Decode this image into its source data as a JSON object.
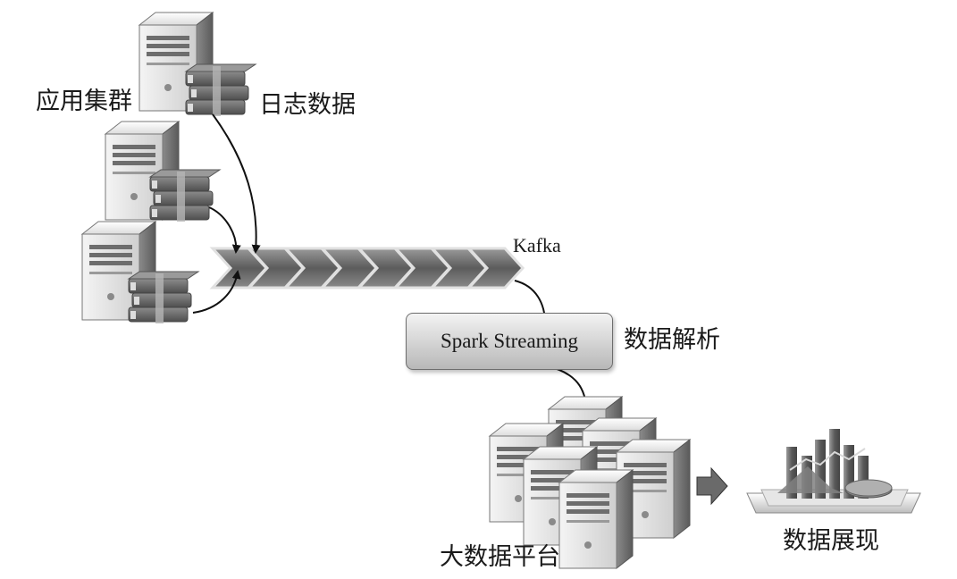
{
  "labels": {
    "app_cluster": "应用集群",
    "log_data": "日志数据",
    "kafka": "Kafka",
    "spark_streaming": "Spark Streaming",
    "data_parsing": "数据解析",
    "big_data_platform": "大数据平台",
    "data_display": "数据展现"
  },
  "icons": {
    "server": "server-icon",
    "log_books": "log-books-icon",
    "queue_chevron": "chevron-icon",
    "platform": "server-cluster-icon",
    "arrow": "arrow-right-icon",
    "dashboard": "chart-dashboard-icon"
  },
  "colors": {
    "server_light": "#e8e8e8",
    "server_dark": "#7a7a7a",
    "chevron": "#6b6b6b",
    "book": "#666666"
  }
}
